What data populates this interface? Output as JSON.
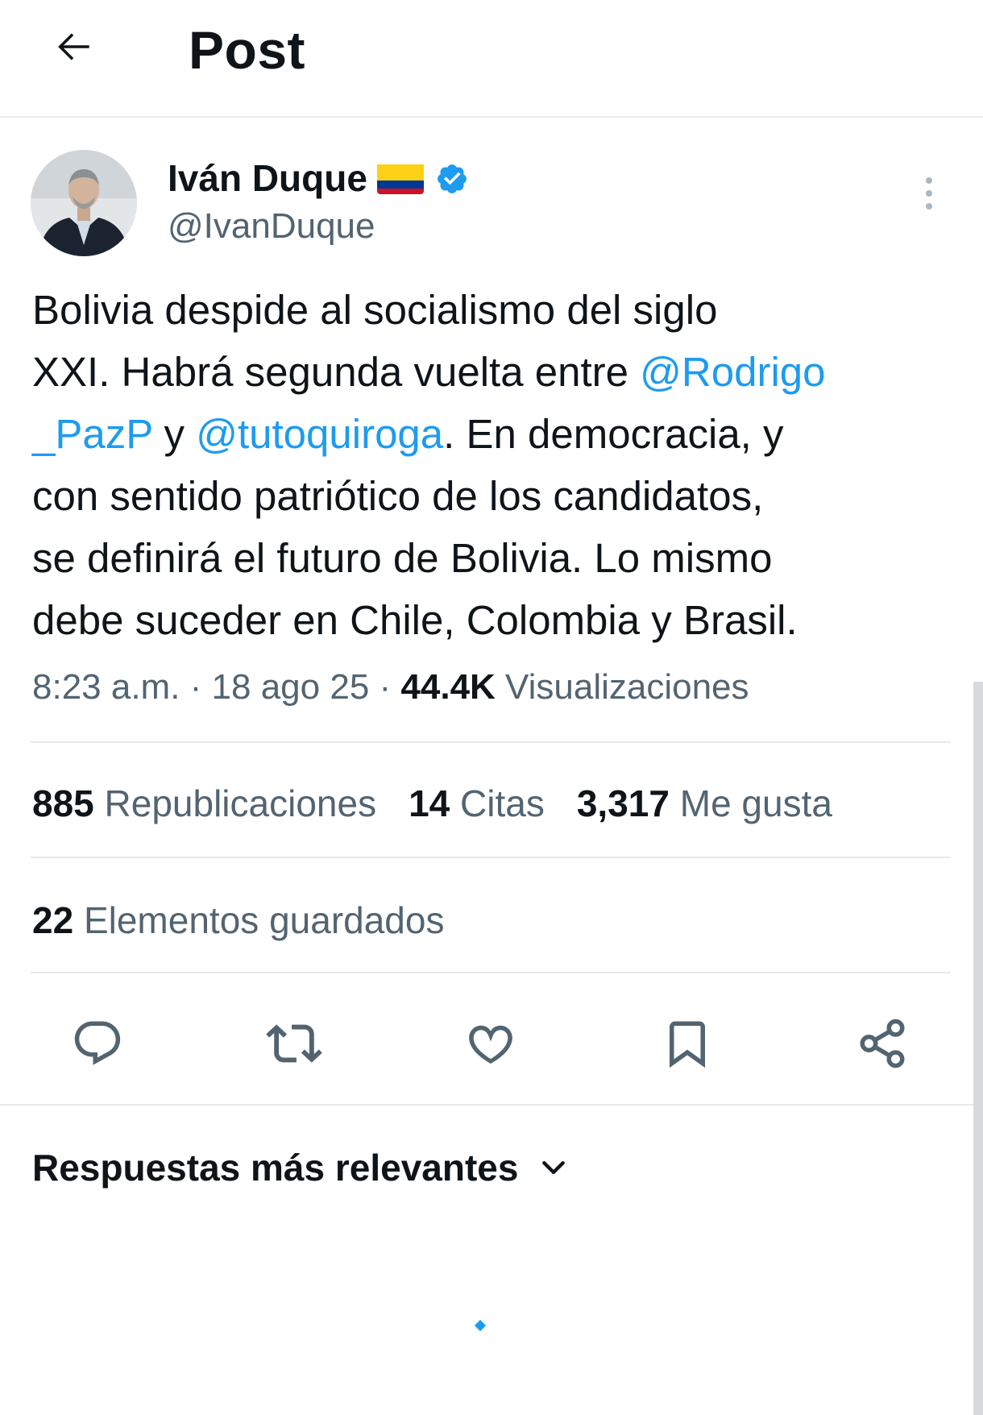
{
  "header": {
    "title": "Post",
    "back_icon": "arrow-left-icon"
  },
  "author": {
    "name": "Iván Duque",
    "handle": "@IvanDuque",
    "flag_icon": "colombia-flag-icon",
    "verified_icon": "verified-badge-icon",
    "verified_color": "#1d9bf0"
  },
  "tweet": {
    "line1": "Bolivia despide al socialismo del siglo",
    "line2_text": "XXI. Habrá segunda vuelta entre ",
    "mention1_a": "@Rodrigo",
    "mention1_b": "_PazP",
    "y_text": " y ",
    "mention2": "@tutoquiroga",
    "line3_text": ". En democracia, y",
    "line4": "con sentido patriótico de los candidatos,",
    "line5": "se definirá el futuro de Bolivia. Lo mismo",
    "line6": "debe suceder en Chile, Colombia y Brasil."
  },
  "meta": {
    "time": "8:23 a.m.",
    "sep1": " · ",
    "date": "18 ago 25",
    "sep2": " · ",
    "views_count": "44.4K",
    "views_label": " Visualizaciones"
  },
  "stats": {
    "reposts_count": "885",
    "reposts_label": " Republicaciones",
    "quotes_count": "14",
    "quotes_label": " Citas",
    "likes_count": "3,317",
    "likes_label": " Me gusta",
    "saved_count": "22",
    "saved_label": " Elementos guardados"
  },
  "actions": {
    "reply_icon": "reply-icon",
    "repost_icon": "repost-icon",
    "like_icon": "heart-icon",
    "bookmark_icon": "bookmark-icon",
    "share_icon": "share-icon"
  },
  "replies": {
    "sort_label": "Respuestas más relevantes",
    "chevron_icon": "chevron-down-icon"
  },
  "colors": {
    "text": "#0f1419",
    "secondary": "#536471",
    "link": "#1d9bf0",
    "divider": "#e6e9ec"
  }
}
